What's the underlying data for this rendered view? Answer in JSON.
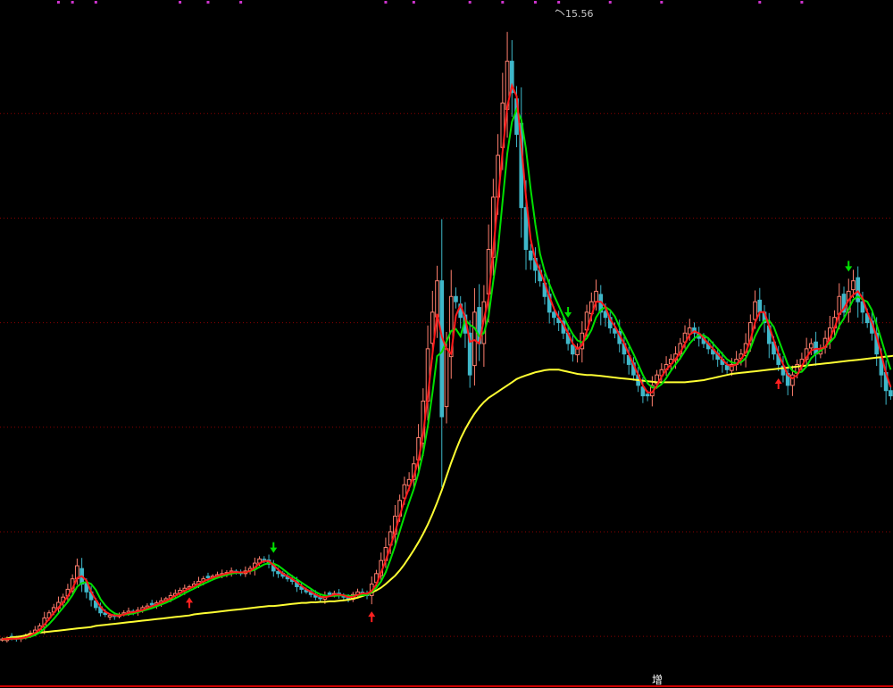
{
  "chart_data": {
    "type": "candlestick",
    "peak_label": "15.56",
    "bottom_label": "增",
    "colors": {
      "background": "#000000",
      "grid": "#8b0000",
      "up_candle": "#ff7f6e",
      "down_candle": "#3fb7c9",
      "ma_short_fast": "#ff1a1a",
      "ma_short_slow": "#00e000",
      "ma_long": "#ffff33",
      "marker_dots": "#cc33cc",
      "buy_arrow": "#ff2020",
      "sell_arrow": "#00e000",
      "bottom_bar": "#cc0000"
    },
    "ylim": [
      3.2,
      16.0
    ],
    "n_bars": 190,
    "grid_values": [
      4.0,
      6.0,
      8.0,
      10.0,
      12.0,
      14.0
    ],
    "close": [
      3.95,
      3.95,
      3.97,
      3.95,
      3.97,
      4.02,
      4.06,
      4.12,
      4.2,
      4.35,
      4.45,
      4.55,
      4.65,
      4.75,
      4.9,
      5.1,
      5.35,
      5.0,
      4.85,
      4.7,
      4.55,
      4.45,
      4.42,
      4.4,
      4.38,
      4.42,
      4.45,
      4.48,
      4.46,
      4.5,
      4.55,
      4.58,
      4.6,
      4.64,
      4.68,
      4.72,
      4.78,
      4.82,
      4.88,
      4.92,
      4.95,
      5.0,
      5.05,
      5.1,
      5.12,
      5.15,
      5.18,
      5.2,
      5.22,
      5.25,
      5.22,
      5.2,
      5.25,
      5.3,
      5.4,
      5.48,
      5.45,
      5.38,
      5.25,
      5.2,
      5.15,
      5.1,
      5.05,
      4.95,
      4.9,
      4.85,
      4.8,
      4.75,
      4.72,
      4.78,
      4.8,
      4.82,
      4.78,
      4.75,
      4.72,
      4.8,
      4.85,
      4.82,
      4.78,
      5.0,
      5.2,
      5.45,
      5.7,
      6.0,
      6.3,
      6.6,
      6.9,
      7.0,
      7.3,
      7.8,
      8.5,
      9.5,
      10.2,
      10.8,
      8.2,
      9.5,
      10.5,
      10.4,
      10.1,
      9.8,
      9.0,
      10.2,
      9.6,
      10.4,
      11.4,
      12.4,
      13.2,
      14.2,
      15.0,
      14.4,
      13.6,
      12.2,
      11.4,
      11.2,
      11.0,
      10.8,
      10.5,
      10.2,
      10.1,
      10.0,
      9.8,
      9.6,
      9.4,
      9.5,
      9.8,
      10.2,
      10.4,
      10.6,
      10.2,
      10.1,
      9.9,
      9.8,
      9.6,
      9.4,
      9.2,
      9.0,
      8.8,
      8.6,
      8.6,
      8.8,
      9.0,
      9.1,
      9.2,
      9.3,
      9.4,
      9.6,
      9.8,
      9.9,
      9.8,
      9.7,
      9.6,
      9.5,
      9.4,
      9.3,
      9.2,
      9.1,
      9.2,
      9.3,
      9.4,
      9.6,
      10.0,
      10.4,
      10.2,
      10.0,
      9.6,
      9.4,
      9.2,
      9.0,
      8.8,
      9.0,
      9.2,
      9.3,
      9.5,
      9.6,
      9.4,
      9.5,
      9.7,
      9.9,
      10.1,
      10.5,
      10.2,
      10.6,
      10.8,
      10.4,
      10.2,
      10.0,
      9.8,
      9.4,
      9.0,
      8.7,
      8.6
    ],
    "ma_long": [
      3.95,
      3.96,
      3.98,
      3.99,
      4.0,
      4.02,
      4.04,
      4.06,
      4.07,
      4.08,
      4.09,
      4.1,
      4.11,
      4.12,
      4.13,
      4.14,
      4.15,
      4.16,
      4.17,
      4.18,
      4.2,
      4.21,
      4.22,
      4.23,
      4.24,
      4.25,
      4.26,
      4.27,
      4.28,
      4.29,
      4.3,
      4.31,
      4.32,
      4.33,
      4.34,
      4.35,
      4.36,
      4.37,
      4.38,
      4.39,
      4.4,
      4.42,
      4.43,
      4.44,
      4.45,
      4.46,
      4.47,
      4.48,
      4.49,
      4.5,
      4.51,
      4.52,
      4.53,
      4.54,
      4.55,
      4.56,
      4.57,
      4.58,
      4.58,
      4.59,
      4.6,
      4.61,
      4.62,
      4.63,
      4.64,
      4.64,
      4.65,
      4.65,
      4.66,
      4.66,
      4.67,
      4.67,
      4.68,
      4.69,
      4.7,
      4.72,
      4.74,
      4.77,
      4.8,
      4.84,
      4.88,
      4.93,
      5.0,
      5.08,
      5.16,
      5.26,
      5.38,
      5.51,
      5.65,
      5.8,
      5.96,
      6.14,
      6.34,
      6.56,
      6.8,
      7.06,
      7.32,
      7.56,
      7.78,
      7.96,
      8.12,
      8.26,
      8.38,
      8.48,
      8.56,
      8.62,
      8.68,
      8.74,
      8.8,
      8.86,
      8.92,
      8.96,
      8.99,
      9.02,
      9.05,
      9.07,
      9.09,
      9.1,
      9.1,
      9.1,
      9.08,
      9.06,
      9.04,
      9.02,
      9.01,
      9.0,
      9.0,
      8.99,
      8.98,
      8.97,
      8.96,
      8.95,
      8.94,
      8.93,
      8.92,
      8.91,
      8.9,
      8.89,
      8.88,
      8.87,
      8.86,
      8.86,
      8.86,
      8.86,
      8.86,
      8.86,
      8.86,
      8.87,
      8.88,
      8.89,
      8.9,
      8.92,
      8.94,
      8.96,
      8.98,
      9.0,
      9.02,
      9.03,
      9.04,
      9.05,
      9.06,
      9.07,
      9.08,
      9.09,
      9.1,
      9.11,
      9.12,
      9.13,
      9.14,
      9.15,
      9.16,
      9.17,
      9.18,
      9.19,
      9.2,
      9.21,
      9.22,
      9.23,
      9.24,
      9.25,
      9.26,
      9.27,
      9.28,
      9.29,
      9.3,
      9.31,
      9.32,
      9.33,
      9.34,
      9.35,
      9.36,
      9.37
    ],
    "arrows": [
      {
        "bar": 40,
        "dir": "up"
      },
      {
        "bar": 58,
        "dir": "down"
      },
      {
        "bar": 79,
        "dir": "up"
      },
      {
        "bar": 121,
        "dir": "down"
      },
      {
        "bar": 166,
        "dir": "up"
      },
      {
        "bar": 181,
        "dir": "down"
      }
    ],
    "marker_dots": [
      [
        12,
        15,
        20
      ],
      [
        38,
        44,
        51
      ],
      [
        82,
        88,
        100
      ],
      [
        107,
        114,
        119
      ],
      [
        130,
        141,
        162,
        171
      ]
    ]
  }
}
